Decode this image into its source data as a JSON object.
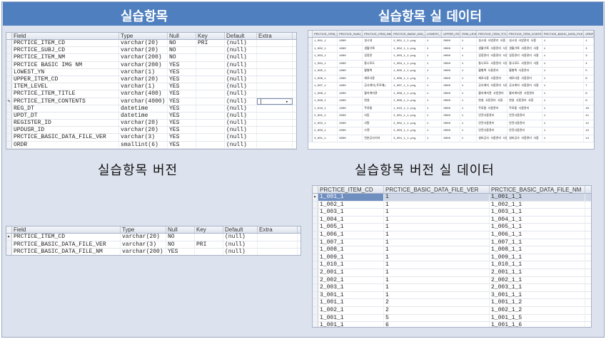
{
  "banner": {
    "left_title": "실습항목",
    "right_title": "실습항목 실 데이터"
  },
  "section_titles": {
    "version_left": "실습항목 버전",
    "version_right": "실습항목 버전 실 데이터"
  },
  "schema1": {
    "columns": [
      "Field",
      "Type",
      "Null",
      "Key",
      "Default",
      "Extra"
    ],
    "rows": [
      {
        "field": "PRCTICE_ITEM_CD",
        "type": "varchar(20)",
        "null": "NO",
        "key": "PRI",
        "def": "(null)",
        "extra": ""
      },
      {
        "field": "PRCTICE_SUBJ_CD",
        "type": "varchar(20)",
        "null": "NO",
        "key": "",
        "def": "(null)",
        "extra": ""
      },
      {
        "field": "PRCTICE_ITEM_NM",
        "type": "varchar(200)",
        "null": "NO",
        "key": "",
        "def": "(null)",
        "extra": ""
      },
      {
        "field": "PRCTICE BASIC IMG NM",
        "type": "varchar(200)",
        "null": "YES",
        "key": "",
        "def": "(null)",
        "extra": ""
      },
      {
        "field": "LOWEST_YN",
        "type": "varchar(1)",
        "null": "YES",
        "key": "",
        "def": "(null)",
        "extra": ""
      },
      {
        "field": "UPPER_ITEM_CD",
        "type": "varchar(20)",
        "null": "YES",
        "key": "",
        "def": "(null)",
        "extra": ""
      },
      {
        "field": "ITEM_LEVEL",
        "type": "varchar(1)",
        "null": "YES",
        "key": "",
        "def": "(null)",
        "extra": ""
      },
      {
        "field": "PRCTICE_ITEM_TITLE",
        "type": "varchar(400)",
        "null": "YES",
        "key": "",
        "def": "(null)",
        "extra": ""
      },
      {
        "field": "PRCTICE_ITEM_CONTENTS",
        "type": "varchar(4000)",
        "null": "YES",
        "key": "",
        "def": "(null)",
        "extra": "|"
      },
      {
        "field": "REG_DT",
        "type": "datetime",
        "null": "YES",
        "key": "",
        "def": "(null)",
        "extra": ""
      },
      {
        "field": "UPDT_DT",
        "type": "datetime",
        "null": "YES",
        "key": "",
        "def": "(null)",
        "extra": ""
      },
      {
        "field": "REGISTER_ID",
        "type": "varchar(20)",
        "null": "YES",
        "key": "",
        "def": "(null)",
        "extra": ""
      },
      {
        "field": "UPDUSR_ID",
        "type": "varchar(20)",
        "null": "YES",
        "key": "",
        "def": "(null)",
        "extra": ""
      },
      {
        "field": "PRCTICE_BASIC_DATA_FILE_VER",
        "type": "varchar(3)",
        "null": "YES",
        "key": "",
        "def": "(null)",
        "extra": ""
      },
      {
        "field": "ORDR",
        "type": "smallint(6)",
        "null": "YES",
        "key": "",
        "def": "(null)",
        "extra": ""
      }
    ]
  },
  "data1": {
    "columns": [
      "PRCTICE_ITEM_CD",
      "PRCTICE_SUBJ_CD",
      "PRCTICE_ITEM_NM",
      "PRCTICE_BASIC_IMG_NM",
      "LOWEST_YN",
      "UPPER_ITEM_CD",
      "ITEM_LEVEL",
      "PRCTICE_ITEM_TITLE",
      "PRCTICE_ITEM_CONTENTS",
      "PRCTICE_BASIC_DATA_FILE_VER",
      "ORDR"
    ],
    "rows": [
      [
        "1_001_1",
        "1000",
        "실시내",
        "1_001_1_1.png",
        "1",
        "0000",
        "1",
        "실시내 사방관리 사용",
        "실시내 사방관리 사용",
        "1",
        "1"
      ],
      [
        "1_002_1",
        "1000",
        "생활기록",
        "1_002_1_1.png",
        "1",
        "0000",
        "1",
        "생활기록 사용관리 사용",
        "생활기록 사용관리 사용",
        "1",
        "2"
      ],
      [
        "1_003_1",
        "1000",
        "일정관",
        "1_003_1_1.png",
        "1",
        "0000",
        "1",
        "일정관리 사용관리 사용",
        "일정관리 사용관리 사용",
        "1",
        "3"
      ],
      [
        "1_004_1",
        "1000",
        "통나모도",
        "1_004_1_1.png",
        "1",
        "0000",
        "1",
        "통나모도 사용관리 사용",
        "통나모도 사용관리 사용",
        "1",
        "4"
      ],
      [
        "1_005_1",
        "1000",
        "활별책",
        "1_005_1_1.png",
        "1",
        "0000",
        "1",
        "활별책 사용관리",
        "활별책 사용관리",
        "1",
        "5"
      ],
      [
        "1_006_1",
        "1000",
        "재료사용",
        "1_006_1_1.png",
        "1",
        "0000",
        "1",
        "재료사용 사용관리",
        "재료사용 사용관리",
        "1",
        "6"
      ],
      [
        "1_007_1",
        "1000",
        "공사계지(트로메)",
        "1_007_1_1.png",
        "1",
        "0000",
        "1",
        "공사계지 사용관리 사용",
        "공사계지 사용관리 사용",
        "1",
        "7"
      ],
      [
        "1_008_1",
        "1000",
        "활지계지관",
        "1_008_1_1.png",
        "1",
        "0000",
        "1",
        "활지계지관 사용관리",
        "활지계지관 사용관리",
        "1",
        "8"
      ],
      [
        "1_009_1",
        "1000",
        "현설",
        "1_009_1_1.png",
        "1",
        "0000",
        "1",
        "현설 사용관리 사용",
        "현설 사용관리 사용",
        "1",
        "9"
      ],
      [
        "1_010_1",
        "1000",
        "주료물",
        "1_010_1_1.png",
        "1",
        "0000",
        "1",
        "주료물 사용관리",
        "주료물 사용관리",
        "1",
        "10"
      ],
      [
        "2_001_1",
        "2000",
        "사등",
        "2_001_1_1.png",
        "1",
        "0000",
        "1",
        "안전사용관리",
        "안전사용관리",
        "1",
        "11"
      ],
      [
        "2_002_1",
        "2000",
        "사탈",
        "2_002_1_1.png",
        "1",
        "0000",
        "1",
        "안전사용관리",
        "안전사용관리",
        "1",
        "12"
      ],
      [
        "2_003_1",
        "2000",
        "스탠",
        "2_003_1_1.png",
        "1",
        "0000",
        "1",
        "안전사용관리",
        "안전사용관리",
        "1",
        "13"
      ],
      [
        "3_001_1",
        "3000",
        "전분공사기지",
        "3_001_1_1.png",
        "1",
        "0000",
        "1",
        "설비공사 사용관리 사용",
        "설비공사 사용관리 사용",
        "1",
        "14"
      ]
    ]
  },
  "schema2": {
    "columns": [
      "Field",
      "Type",
      "Null",
      "Key",
      "Default",
      "Extra"
    ],
    "rows": [
      {
        "field": "PRCTICE_ITEM_CD",
        "type": "varchar(20)",
        "null": "NO",
        "key": "",
        "def": "(null)",
        "extra": ""
      },
      {
        "field": "PRCTICE_BASIC_DATA_FILE_VER",
        "type": "varchar(3)",
        "null": "NO",
        "key": "PRI",
        "def": "(null)",
        "extra": ""
      },
      {
        "field": "PRCTICE_BASIC_DATA_FILE_NM",
        "type": "varchar(200)",
        "null": "YES",
        "key": "",
        "def": "(null)",
        "extra": ""
      }
    ]
  },
  "data2": {
    "columns": [
      "PRCTICE_ITEM_CD",
      "PRCTICE_BASIC_DATA_FILE_VER",
      "PRCTICE_BASIC_DATA_FILE_NM"
    ],
    "rows": [
      [
        "1_001_1",
        "1",
        "1_001_1_1"
      ],
      [
        "1_002_1",
        "1",
        "1_002_1_1"
      ],
      [
        "1_003_1",
        "1",
        "1_003_1_1"
      ],
      [
        "1_004_1",
        "1",
        "1_004_1_1"
      ],
      [
        "1_005_1",
        "1",
        "1_005_1_1"
      ],
      [
        "1_006_1",
        "1",
        "1_006_1_1"
      ],
      [
        "1_007_1",
        "1",
        "1_007_1_1"
      ],
      [
        "1_008_1",
        "1",
        "1_008_1_1"
      ],
      [
        "1_009_1",
        "1",
        "1_009_1_1"
      ],
      [
        "1_010_1",
        "1",
        "1_010_1_1"
      ],
      [
        "2_001_1",
        "1",
        "2_001_1_1"
      ],
      [
        "2_002_1",
        "1",
        "2_002_1_1"
      ],
      [
        "2_003_1",
        "1",
        "2_003_1_1"
      ],
      [
        "3_001_1",
        "1",
        "3_001_1_1"
      ],
      [
        "1_001_1",
        "2",
        "1_001_1_2"
      ],
      [
        "1_002_1",
        "2",
        "1_002_1_2"
      ],
      [
        "1_001_1",
        "5",
        "1_001_1_5"
      ],
      [
        "1_001_1",
        "6",
        "1_001_1_6"
      ]
    ]
  }
}
